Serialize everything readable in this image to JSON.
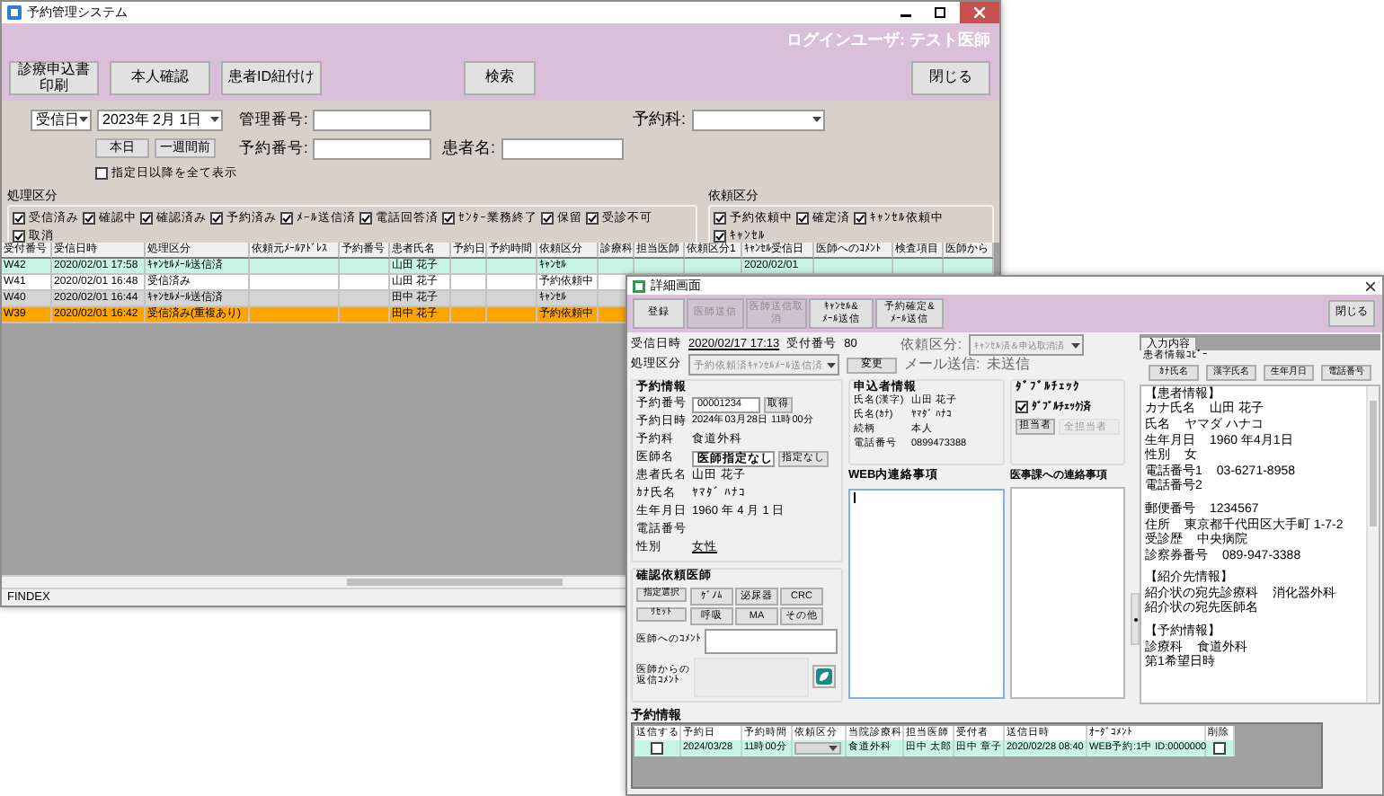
{
  "main_window": {
    "title": "予約管理システム",
    "login_user": "ログインユーザ: テスト医師",
    "left_buttons": [
      "診療申込書印刷",
      "本人確認",
      "患者ID紐付け"
    ],
    "center_buttons": [
      "検索"
    ],
    "right_buttons": [
      "閉じる"
    ],
    "filters": {
      "date_type": "受信日",
      "date": "2023年 2月 1日",
      "today_button": "本日",
      "week_ago_button": "一週間前",
      "show_all": {
        "label": "指定日以降を全て表示",
        "checked": false
      },
      "management_no_label": "管理番号:",
      "department_label": "予約科:",
      "reservation_no_label": "予約番号:",
      "patient_name_label": "患者名:"
    },
    "status_group": {
      "title": "処理区分",
      "options": [
        {
          "label": "受信済み",
          "checked": true
        },
        {
          "label": "確認中",
          "checked": true
        },
        {
          "label": "確認済み",
          "checked": true
        },
        {
          "label": "予約済み",
          "checked": true
        },
        {
          "label": "ﾒｰﾙ送信済",
          "checked": true
        },
        {
          "label": "電話回答済",
          "checked": true
        },
        {
          "label": "ｾﾝﾀｰ業務終了",
          "checked": true
        },
        {
          "label": "保留",
          "checked": true
        },
        {
          "label": "受診不可",
          "checked": true
        },
        {
          "label": "取消",
          "checked": true
        }
      ]
    },
    "request_group": {
      "title": "依頼区分",
      "options": [
        {
          "label": "予約依頼中",
          "checked": true
        },
        {
          "label": "確定済",
          "checked": true
        },
        {
          "label": "ｷｬﾝｾﾙ依頼中",
          "checked": true
        },
        {
          "label": "ｷｬﾝｾﾙ",
          "checked": true
        }
      ]
    },
    "table": {
      "columns": [
        "受付番号",
        "受信日時",
        "処理区分",
        "依頼元ﾒｰﾙｱﾄﾞﾚｽ",
        "予約番号",
        "患者氏名",
        "予約日",
        "予約時間",
        "依頼区分",
        "診療科",
        "担当医師",
        "依頼区分1",
        "ｷｬﾝｾﾙ受信日",
        "医師へのｺﾒﾝﾄ",
        "検査項目",
        "医師から"
      ],
      "rows": [
        {
          "color": "#c8f4e6",
          "number": "W42",
          "received": "2020/02/01 17:58",
          "status": "ｷｬﾝｾﾙﾒｰﾙ送信済",
          "patient": "山田 花子",
          "request_type": "ｷｬﾝｾﾙ",
          "cancel_date": "2020/02/01"
        },
        {
          "color": "#ffffff",
          "number": "W41",
          "received": "2020/02/01 16:48",
          "status": "受信済み",
          "patient": "山田 花子",
          "request_type": "予約依頼中"
        },
        {
          "color": "#d4d4d4",
          "number": "W40",
          "received": "2020/02/01 16:44",
          "status": "ｷｬﾝｾﾙﾒｰﾙ送信済",
          "patient": "田中 花子",
          "request_type": "ｷｬﾝｾﾙ"
        },
        {
          "color": "#ffa500",
          "number": "W39",
          "received": "2020/02/01 16:42",
          "status": "受信済み(重複あり)",
          "patient": "田中 花子",
          "request_type": "予約依頼中"
        }
      ]
    },
    "status_bar": "FINDEX"
  },
  "detail_window": {
    "title": "詳細画面",
    "toolbar_buttons": [
      {
        "label": "登録",
        "disabled": false
      },
      {
        "label": "医師送信",
        "disabled": true
      },
      {
        "label": "医師送信取消",
        "disabled": true
      },
      {
        "label": "ｷｬﾝｾﾙ&\nﾒｰﾙ送信",
        "disabled": false
      },
      {
        "label": "予約確定&\nﾒｰﾙ送信",
        "disabled": false
      }
    ],
    "close_button": "閉じる",
    "received": {
      "label": "受信日時",
      "value": "2020/02/17 17:13"
    },
    "receipt_no": {
      "label": "受付番号",
      "value": "80"
    },
    "status": {
      "label": "処理区分",
      "value": "予約依頼済ｷｬﾝｾﾙﾒｰﾙ送信済",
      "button": "変更"
    },
    "request_type": {
      "label": "依頼区分:",
      "value": "ｷｬﾝｾﾙ済＆申込取消済"
    },
    "mail": {
      "label": "メール送信:",
      "value": "未送信"
    },
    "reservation": {
      "title": "予約情報",
      "fields": [
        {
          "kind": "input",
          "label": "予約番号",
          "value": "00001234",
          "button": "取得"
        },
        {
          "kind": "text",
          "label": "予約日時",
          "value": "2024年03月28日 11時00分"
        },
        {
          "kind": "text",
          "label": "予約科",
          "value": "食道外科"
        },
        {
          "kind": "input",
          "label": "医師名",
          "value": "医師指定なし",
          "button": "指定なし"
        },
        {
          "kind": "text",
          "label": "患者氏名",
          "value": "山田 花子"
        },
        {
          "kind": "text",
          "label": "ｶﾅ氏名",
          "value": "ﾔﾏﾀﾞ ﾊﾅｺ"
        },
        {
          "kind": "text",
          "label": "生年月日",
          "value": "1960 年 4 月 1 日"
        },
        {
          "kind": "text",
          "label": "電話番号"
        },
        {
          "kind": "link",
          "label": "性別",
          "value": "女性"
        }
      ]
    },
    "doctor_request": {
      "title": "確認依頼医師",
      "side_buttons": [
        "指定選択",
        "ﾘｾｯﾄ"
      ],
      "doctor_buttons": [
        "ｹﾞﾉﾑ",
        "泌尿器",
        "CRC",
        "呼吸",
        "MA",
        "その他"
      ],
      "comment_label": "医師へのｺﾒﾝﾄ",
      "reply_label": "医師からの返信ｺﾒﾝﾄ"
    },
    "applicant": {
      "title": "申込者情報",
      "fields": [
        {
          "label": "氏名(漢字)",
          "value": "山田 花子"
        },
        {
          "label": "氏名(ｶﾅ)",
          "value": "ﾔﾏﾀﾞ ﾊﾅｺ"
        },
        {
          "label": "続柄",
          "value": "本人"
        },
        {
          "label": "電話番号",
          "value": "0899473388"
        }
      ]
    },
    "double_check": {
      "title": "ﾀﾞﾌﾞﾙﾁｪｯｸ",
      "checkbox": {
        "label": "ﾀﾞﾌﾞﾙﾁｪｯｸ済",
        "checked": true
      },
      "button": "担当者",
      "field": "全担当者"
    },
    "web_notes": {
      "label": "WEB内連絡事項"
    },
    "office_notes": {
      "label": "医事課への連絡事項"
    },
    "copy_panel": {
      "tab": "入力内容",
      "title": "患者情報ｺﾋﾟｰ",
      "buttons": [
        "ｶﾅ氏名",
        "漢字氏名",
        "生年月日",
        "電話番号"
      ],
      "lines": [
        {
          "kind": "heading",
          "text": "【患者情報】"
        },
        {
          "kind": "field",
          "label": "カナ氏名",
          "value": "山田 花子"
        },
        {
          "kind": "field",
          "label": "氏名",
          "value": "ヤマダ ハナコ"
        },
        {
          "kind": "field",
          "label": "生年月日",
          "value": "1960 年4月1日"
        },
        {
          "kind": "field",
          "label": "性別",
          "value": "女"
        },
        {
          "kind": "field",
          "label": "電話番号1",
          "value": "03-6271-8958"
        },
        {
          "kind": "field",
          "label": "電話番号2"
        },
        {
          "kind": "gap"
        },
        {
          "kind": "field",
          "label": "郵便番号",
          "value": "1234567"
        },
        {
          "kind": "field",
          "label": "住所",
          "value": "東京都千代田区大手町 1-7-2"
        },
        {
          "kind": "field",
          "label": "受診歴",
          "value": "中央病院"
        },
        {
          "kind": "field",
          "label": "診察券番号",
          "value": "089-947-3388"
        },
        {
          "kind": "gap"
        },
        {
          "kind": "heading",
          "text": "【紹介先情報】"
        },
        {
          "kind": "field",
          "label": "紹介状の宛先診療科",
          "value": "消化器外科"
        },
        {
          "kind": "field",
          "label": "紹介状の宛先医師名"
        },
        {
          "kind": "gap"
        },
        {
          "kind": "heading",
          "text": "【予約情報】"
        },
        {
          "kind": "field",
          "label": "診療科",
          "value": "食道外科"
        },
        {
          "kind": "field",
          "label": "第1希望日時"
        }
      ]
    },
    "reservations_table": {
      "title": "予約情報",
      "columns": [
        "送信する",
        "予約日",
        "予約時間",
        "依頼区分",
        "当院診療科",
        "担当医師",
        "受付者",
        "送信日時",
        "ｵｰﾀﾞｺﾒﾝﾄ",
        "削除"
      ],
      "rows": [
        {
          "send": false,
          "date": "2024/03/28",
          "time": "11時00分",
          "department": "食道外科",
          "doctor": "田中 太郎",
          "receiver": "田中 章子",
          "sent_at": "2020/02/28 08:40",
          "comment": "WEB予約:1中 ID:0000000",
          "delete": false
        }
      ]
    }
  }
}
